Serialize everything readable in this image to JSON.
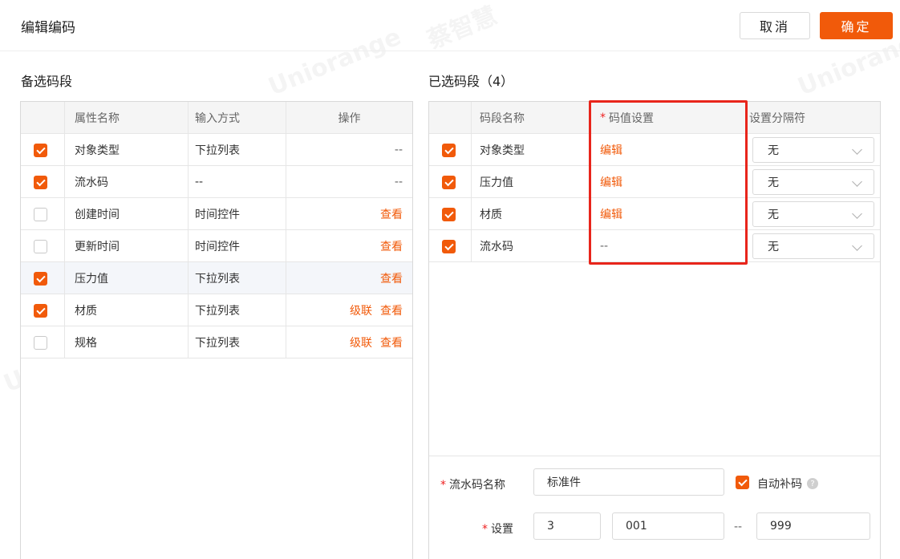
{
  "header": {
    "title": "编辑编码",
    "cancel_label": "取消",
    "ok_label": "确定"
  },
  "left": {
    "title": "备选码段",
    "columns": [
      "属性名称",
      "输入方式",
      "操作"
    ],
    "rows": [
      {
        "name": "对象类型",
        "input": "下拉列表",
        "checked": true,
        "ops": [],
        "op_text": "--"
      },
      {
        "name": "流水码",
        "input": "--",
        "checked": true,
        "ops": [],
        "op_text": "--"
      },
      {
        "name": "创建时间",
        "input": "时间控件",
        "checked": false,
        "ops": [
          "查看"
        ]
      },
      {
        "name": "更新时间",
        "input": "时间控件",
        "checked": false,
        "ops": [
          "查看"
        ]
      },
      {
        "name": "压力值",
        "input": "下拉列表",
        "checked": true,
        "ops": [
          "查看"
        ]
      },
      {
        "name": "材质",
        "input": "下拉列表",
        "checked": true,
        "ops": [
          "级联",
          "查看"
        ]
      },
      {
        "name": "规格",
        "input": "下拉列表",
        "checked": false,
        "ops": [
          "级联",
          "查看"
        ]
      }
    ]
  },
  "right": {
    "title": "已选码段（4）",
    "columns": [
      "码段名称",
      "码值设置",
      "设置分隔符"
    ],
    "rows": [
      {
        "name": "对象类型",
        "value": "编辑",
        "value_link": true,
        "sep": "无"
      },
      {
        "name": "压力值",
        "value": "编辑",
        "value_link": true,
        "sep": "无"
      },
      {
        "name": "材质",
        "value": "编辑",
        "value_link": true,
        "sep": "无"
      },
      {
        "name": "流水码",
        "value": "--",
        "value_link": false,
        "sep": "无"
      }
    ]
  },
  "serial": {
    "name_label": "流水码名称",
    "name_value": "标准件",
    "auto_label": "自动补码",
    "auto_checked": true,
    "setting_label": "设置",
    "setting_value": "3",
    "start_value": "001",
    "range_sep": "--",
    "end_value": "999"
  },
  "required_mark": "*",
  "help_glyph": "?",
  "watermarks": [
    "Uniorange",
    "蔡智慧"
  ],
  "colors": {
    "accent": "#f15a0a",
    "highlight_box": "#e8251b"
  }
}
